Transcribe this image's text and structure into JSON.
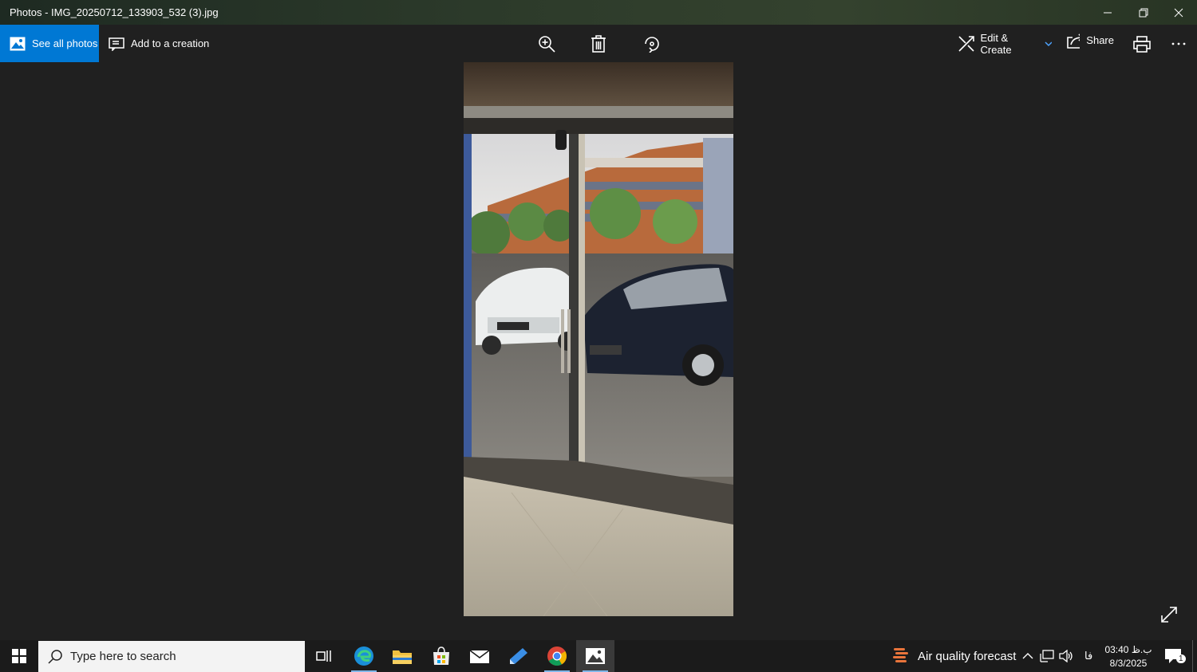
{
  "window": {
    "title": "Photos - IMG_20250712_133903_532 (3).jpg"
  },
  "toolbar": {
    "see_all_label": "See all photos",
    "add_creation_label": "Add to a creation",
    "edit_create_label": "Edit & Create",
    "share_label": "Share"
  },
  "taskbar": {
    "search_placeholder": "Type here to search",
    "weather_label": "Air quality forecast",
    "lang": "فا",
    "time": "03:40 ب.ظ",
    "date": "8/3/2025",
    "notification_count": "1"
  },
  "colors": {
    "accent": "#0078d4",
    "background": "#202020",
    "taskbar": "#1b1b1b"
  },
  "icons": {
    "zoom": "zoom-in-icon",
    "delete": "trash-icon",
    "rotate": "rotate-icon",
    "print": "printer-icon",
    "more": "more-icon"
  }
}
